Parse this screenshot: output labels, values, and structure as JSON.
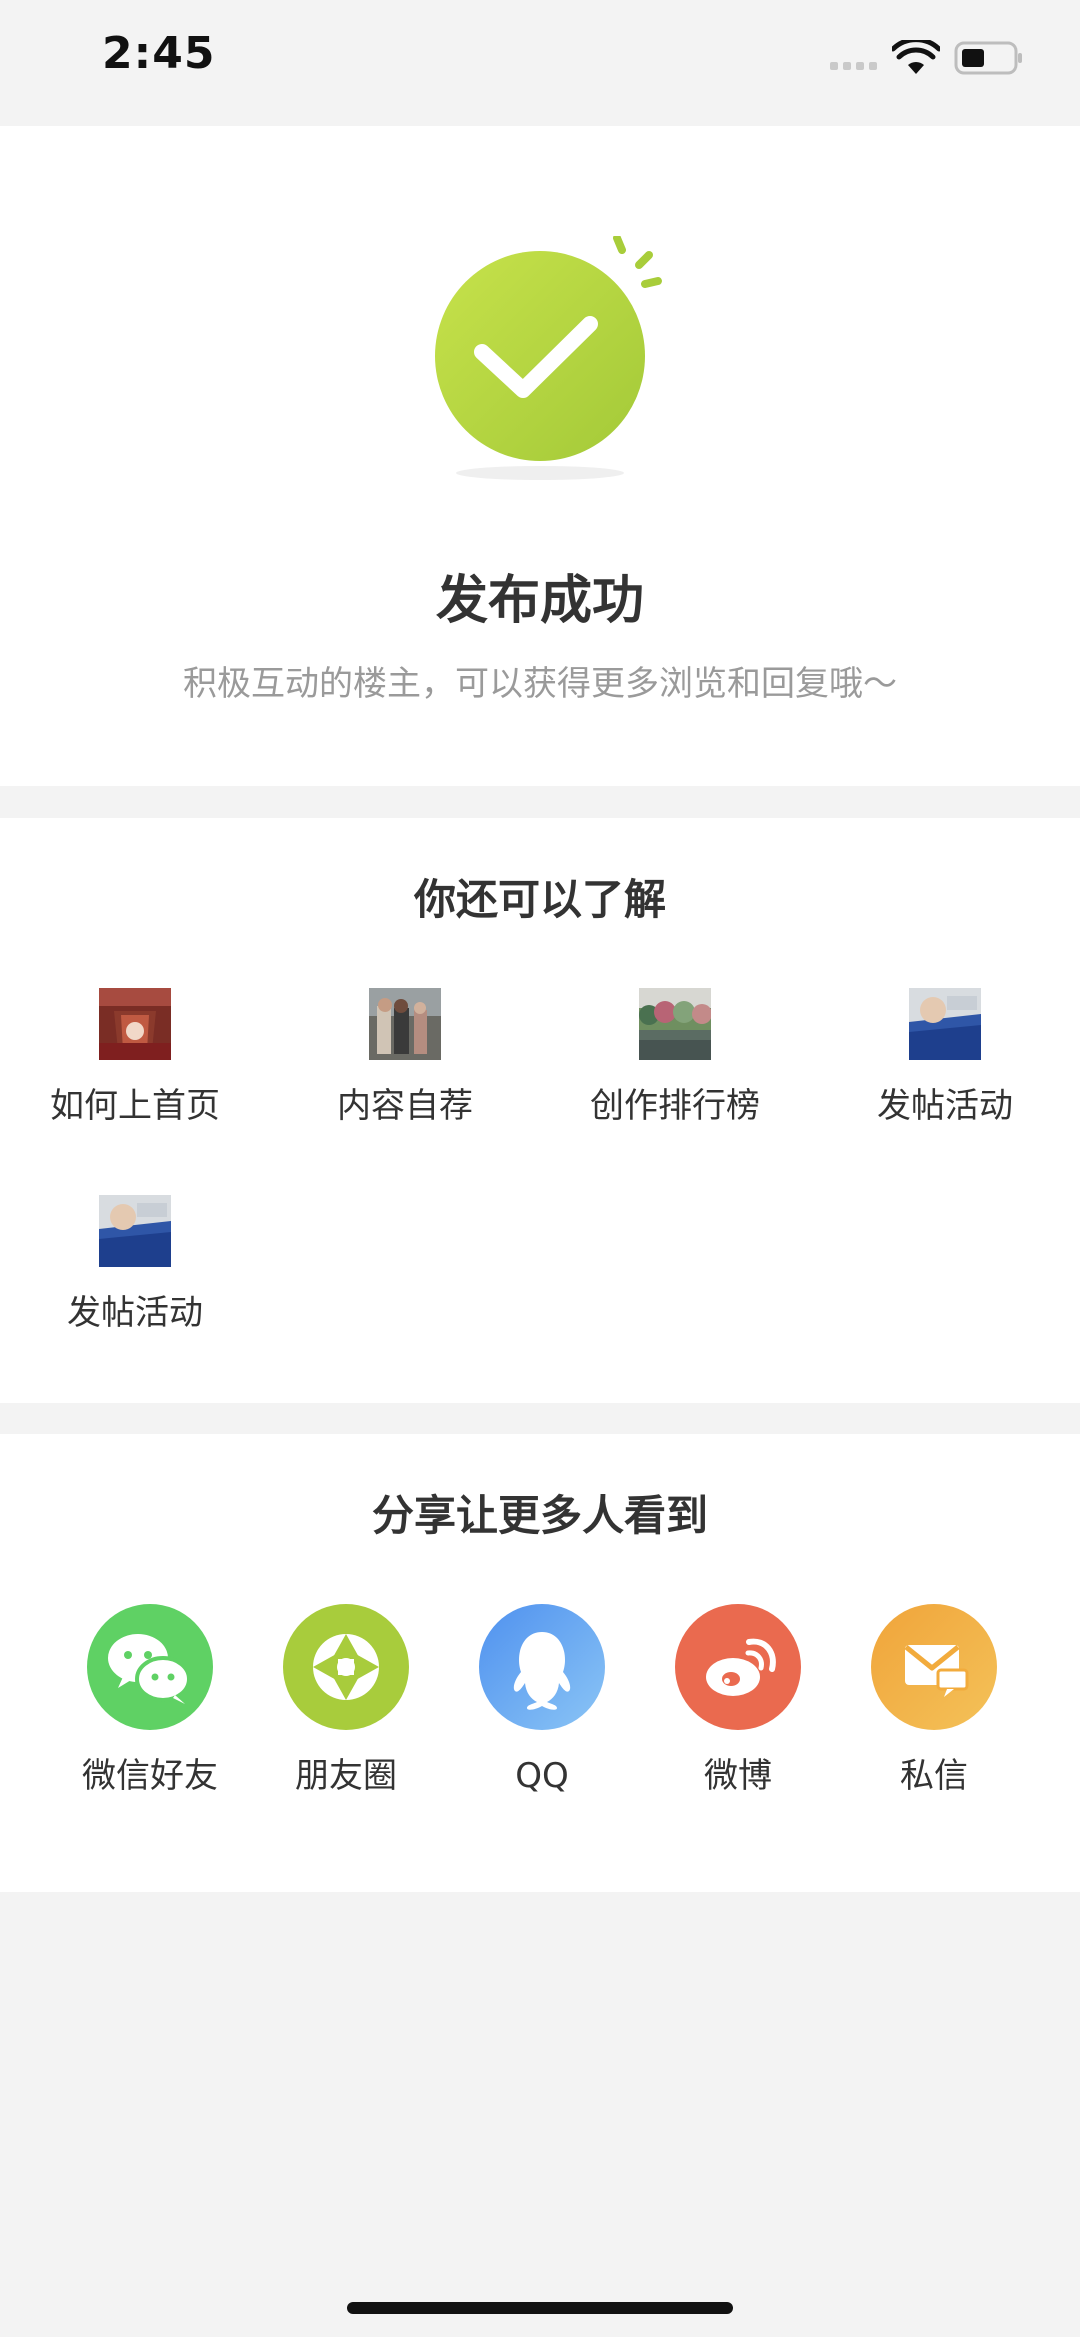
{
  "status_bar": {
    "time": "2:45",
    "icons": [
      "signal-dots-icon",
      "wifi-icon",
      "battery-icon"
    ]
  },
  "success": {
    "icon": "check-circle-icon",
    "title": "发布成功",
    "subtitle": "积极互动的楼主，可以获得更多浏览和回复哦～",
    "accent_color": "#a8cd3a"
  },
  "learn_more": {
    "title": "你还可以了解",
    "items": [
      {
        "label": "如何上首页",
        "icon": "thumbnail-image-icon"
      },
      {
        "label": "内容自荐",
        "icon": "thumbnail-image-icon"
      },
      {
        "label": "创作排行榜",
        "icon": "thumbnail-image-icon"
      },
      {
        "label": "发帖活动",
        "icon": "thumbnail-image-icon"
      },
      {
        "label": "发帖活动",
        "icon": "thumbnail-image-icon"
      }
    ]
  },
  "share": {
    "title": "分享让更多人看到",
    "items": [
      {
        "label": "微信好友",
        "icon": "wechat-icon",
        "color": "#5cd15f"
      },
      {
        "label": "朋友圈",
        "icon": "moments-icon",
        "color": "#a8cc3c"
      },
      {
        "label": "QQ",
        "icon": "qq-icon",
        "color": "#5ea5ef"
      },
      {
        "label": "微博",
        "icon": "weibo-icon",
        "color": "#e9684d"
      },
      {
        "label": "私信",
        "icon": "message-icon",
        "color": "#f2ab3c"
      }
    ]
  }
}
